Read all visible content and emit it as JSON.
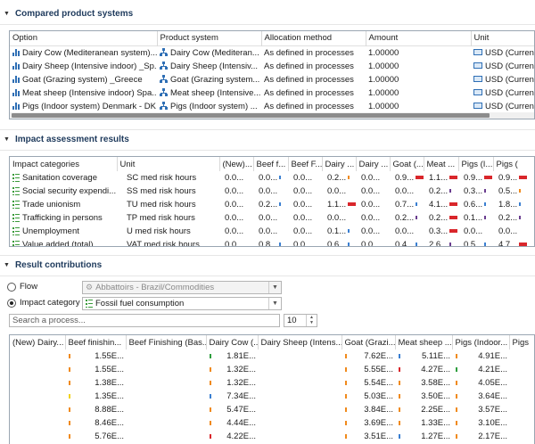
{
  "sections": {
    "compared": "Compared product systems",
    "impact": "Impact assessment results",
    "contributions": "Result contributions"
  },
  "compared_table": {
    "headers": [
      "Option",
      "Product system",
      "Allocation method",
      "Amount",
      "Unit"
    ],
    "rows": [
      [
        "Dairy Cow (Mediteranean system)...",
        "Dairy Cow (Mediteran...",
        "As defined in processes",
        "1.00000",
        "USD (Currenci"
      ],
      [
        "Dairy Sheep (Intensive indoor) _Sp...",
        "Dairy Sheep (Intensiv...",
        "As defined in processes",
        "1.00000",
        "USD (Currenci"
      ],
      [
        "Goat (Grazing system) _Greece",
        "Goat (Grazing system...",
        "As defined in processes",
        "1.00000",
        "USD (Currenci"
      ],
      [
        "Meat sheep (Intensive indoor) Spa...",
        "Meat sheep (Intensive...",
        "As defined in processes",
        "1.00000",
        "USD (Currenci"
      ],
      [
        "Pigs (Indoor system) Denmark - DK",
        "Pigs (Indoor system) ...",
        "As defined in processes",
        "1.00000",
        "USD (Currenci"
      ]
    ]
  },
  "impact_table": {
    "headers": [
      "Impact categories",
      "Unit",
      "(New)...",
      "Beef f...",
      "Beef F...",
      "Dairy ...",
      "Dairy ...",
      "Goat (...",
      "Meat ...",
      "Pigs (I...",
      "Pigs ("
    ],
    "rows": [
      {
        "name": "Sanitation coverage",
        "unit": "SC med risk hours",
        "cells": [
          "0.0...",
          "0.0...",
          "0.0...",
          "0.2...",
          "0.0...",
          "0.9...",
          "1.1...",
          "0.9...",
          "0.9..."
        ]
      },
      {
        "name": "Social security expendi...",
        "unit": "SS med risk hours",
        "cells": [
          "0.0...",
          "0.0...",
          "0.0...",
          "0.0...",
          "0.0...",
          "0.0...",
          "0.2...",
          "0.3...",
          "0.5..."
        ]
      },
      {
        "name": "Trade unionism",
        "unit": "TU med risk hours",
        "cells": [
          "0.0...",
          "0.2...",
          "0.0...",
          "1.1...",
          "0.0...",
          "0.7...",
          "4.1...",
          "0.6...",
          "1.8..."
        ]
      },
      {
        "name": "Trafficking in persons",
        "unit": "TP med risk hours",
        "cells": [
          "0.0...",
          "0.0...",
          "0.0...",
          "0.0...",
          "0.0...",
          "0.2...",
          "0.2...",
          "0.1...",
          "0.2..."
        ]
      },
      {
        "name": "Unemployment",
        "unit": "U med risk hours",
        "cells": [
          "0.0...",
          "0.0...",
          "0.0...",
          "0.1...",
          "0.0...",
          "0.0...",
          "0.3...",
          "0.0...",
          "0.0..."
        ]
      },
      {
        "name": "Value added (total)",
        "unit": "VAT med risk hours",
        "cells": [
          "0.0...",
          "0.8...",
          "0.0...",
          "0.6...",
          "0.0...",
          "0.4...",
          "2.6...",
          "0.5...",
          "4.7..."
        ]
      }
    ]
  },
  "contrib": {
    "flow_label": "Flow",
    "flow_value": "Abbattoirs - Brazil/Commodities",
    "impact_label": "Impact category",
    "impact_value": "Fossil fuel consumption",
    "search_placeholder": "Search a process...",
    "count": "10",
    "headers": [
      "(New) Dairy...",
      "Beef finishin...",
      "Beef Finishing (Bas...",
      "Dairy Cow (...",
      "Dairy Sheep (Intens...",
      "Goat (Grazi...",
      "Meat sheep ...",
      "Pigs (Indoor...",
      "Pigs"
    ],
    "rows": [
      [
        "",
        "1.55E...",
        "",
        "1.81E...",
        "",
        "7.62E...",
        "5.11E...",
        "4.91E...",
        ""
      ],
      [
        "",
        "1.55E...",
        "",
        "1.32E...",
        "",
        "5.55E...",
        "4.27E...",
        "4.21E...",
        ""
      ],
      [
        "",
        "1.38E...",
        "",
        "1.32E...",
        "",
        "5.54E...",
        "3.58E...",
        "4.05E...",
        ""
      ],
      [
        "",
        "1.35E...",
        "",
        "7.34E...",
        "",
        "5.03E...",
        "3.50E...",
        "3.64E...",
        ""
      ],
      [
        "",
        "8.88E...",
        "",
        "5.47E...",
        "",
        "3.84E...",
        "2.25E...",
        "3.57E...",
        ""
      ],
      [
        "",
        "8.46E...",
        "",
        "4.44E...",
        "",
        "3.69E...",
        "1.33E...",
        "3.10E...",
        ""
      ],
      [
        "",
        "5.76E...",
        "",
        "4.22E...",
        "",
        "3.51E...",
        "1.27E...",
        "2.17E...",
        ""
      ]
    ]
  },
  "colors": {
    "section_title": "#1e3a5c",
    "icon_blue": "#2f6fb5",
    "icon_green": "#3a9a3a",
    "mark_red": "#d9262b",
    "mark_blue": "#3a7fd1",
    "mark_purple": "#6a3d8f",
    "mark_orange": "#f08a1c",
    "mark_green": "#2e9e3e",
    "mark_yellow": "#f2d21c"
  }
}
